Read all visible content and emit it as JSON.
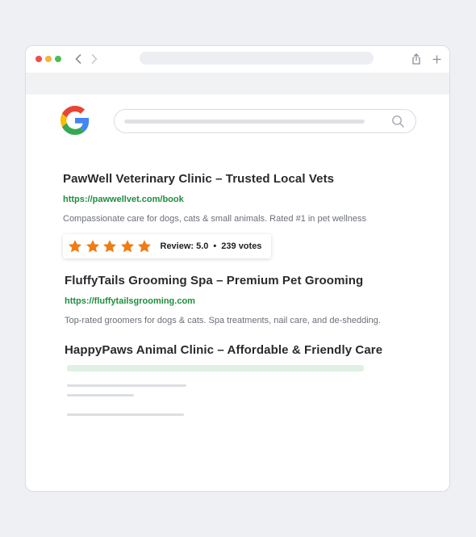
{
  "browser": {
    "window_controls": [
      "close",
      "minimize",
      "maximize"
    ],
    "icons": [
      "back-arrow-icon",
      "forward-arrow-icon",
      "share-icon",
      "plus-icon"
    ]
  },
  "search": {
    "logo": "Google",
    "icon": "search-icon"
  },
  "results": [
    {
      "title": "PawWell Veterinary Clinic – Trusted Local Vets",
      "url": "https://pawwellvet.com/book",
      "description": "Compassionate care for dogs, cats & small animals. Rated #1 in pet wellness",
      "rating": {
        "stars": 5,
        "review_label": "Review: 5.0",
        "separator": "•",
        "votes_label": "239 votes"
      }
    },
    {
      "title": "FluffyTails Grooming Spa – Premium Pet Grooming",
      "url": "https://fluffytailsgrooming.com",
      "description": "Top-rated groomers for dogs & cats. Spa treatments, nail care, and de-shedding."
    },
    {
      "title": "HappyPaws Animal Clinic – Affordable & Friendly Care"
    }
  ],
  "colors": {
    "url_green": "#1e8e3e",
    "star_orange": "#f07c14",
    "title_text": "#2a2a2e"
  }
}
